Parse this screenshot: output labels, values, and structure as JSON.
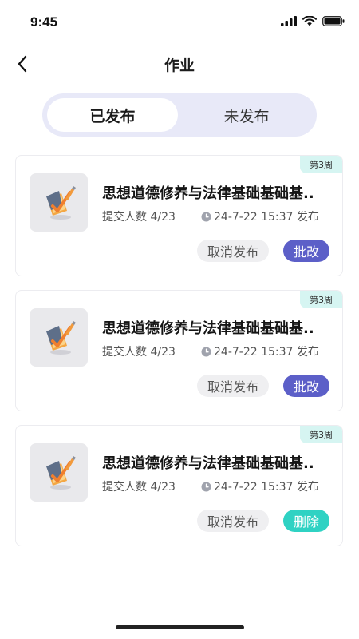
{
  "status": {
    "time": "9:45"
  },
  "nav": {
    "title": "作业"
  },
  "tabs": [
    {
      "label": "已发布",
      "active": true
    },
    {
      "label": "未发布",
      "active": false
    }
  ],
  "cards": [
    {
      "week": "第3周",
      "title": "思想道德修养与法律基础基础基..",
      "count": "提交人数 4/23",
      "time": "24-7-22 15:37 发布",
      "cancel_label": "取消发布",
      "action_label": "批改",
      "action_type": "grade"
    },
    {
      "week": "第3周",
      "title": "思想道德修养与法律基础基础基..",
      "count": "提交人数 4/23",
      "time": "24-7-22 15:37 发布",
      "cancel_label": "取消发布",
      "action_label": "批改",
      "action_type": "grade"
    },
    {
      "week": "第3周",
      "title": "思想道德修养与法律基础基础基..",
      "count": "提交人数 4/23",
      "time": "24-7-22 15:37 发布",
      "cancel_label": "取消发布",
      "action_label": "删除",
      "action_type": "delete"
    }
  ],
  "icons": {
    "back": "chevron-left-icon",
    "signal": "signal-icon",
    "wifi": "wifi-icon",
    "battery": "battery-icon",
    "clock": "clock-icon",
    "thumb": "pencil-paper-icon"
  },
  "colors": {
    "accent": "#5c5fc8",
    "delete": "#2fd2c3",
    "tab_bg": "#e8e9f8",
    "week_badge": "#d6f5f2"
  }
}
